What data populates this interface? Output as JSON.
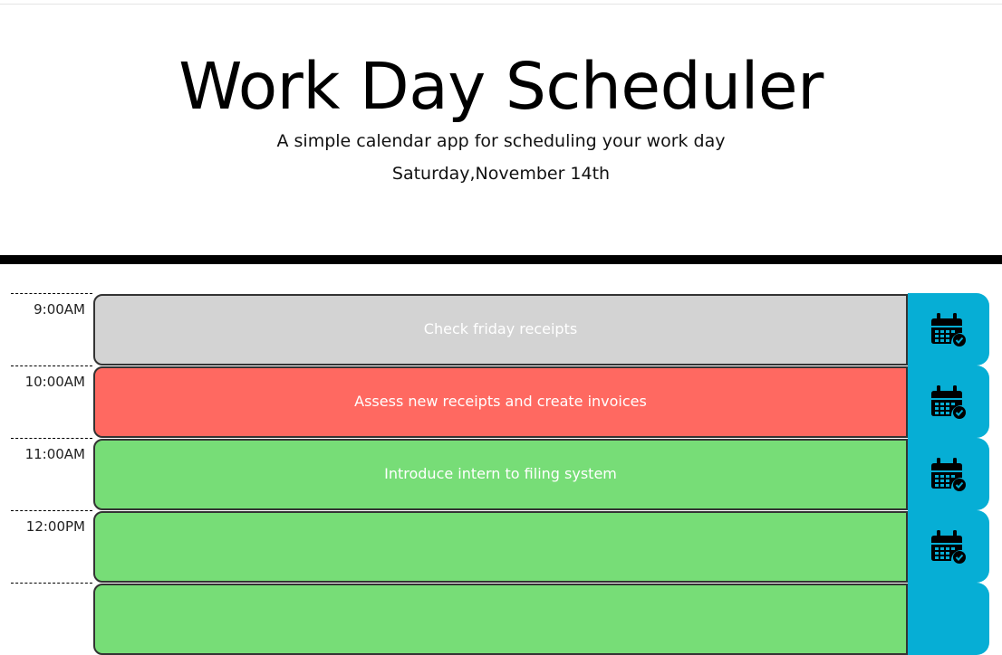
{
  "header": {
    "title": "Work Day Scheduler",
    "subtitle": "A simple calendar app for scheduling your work day",
    "current_date": "Saturday,November 14th"
  },
  "rows": [
    {
      "hour": "9:00AM",
      "text": "Check friday receipts",
      "status": "past"
    },
    {
      "hour": "10:00AM",
      "text": "Assess new receipts and create invoices",
      "status": "present"
    },
    {
      "hour": "11:00AM",
      "text": "Introduce intern to filing system",
      "status": "future"
    },
    {
      "hour": "12:00PM",
      "text": "",
      "status": "future"
    },
    {
      "hour": "",
      "text": "",
      "status": "future"
    }
  ],
  "save_icon": "calendar-check-icon",
  "colors": {
    "past": "#d3d3d3",
    "present": "#ff6961",
    "future": "#77dd77",
    "save": "#06aed5",
    "divider": "#000000"
  }
}
